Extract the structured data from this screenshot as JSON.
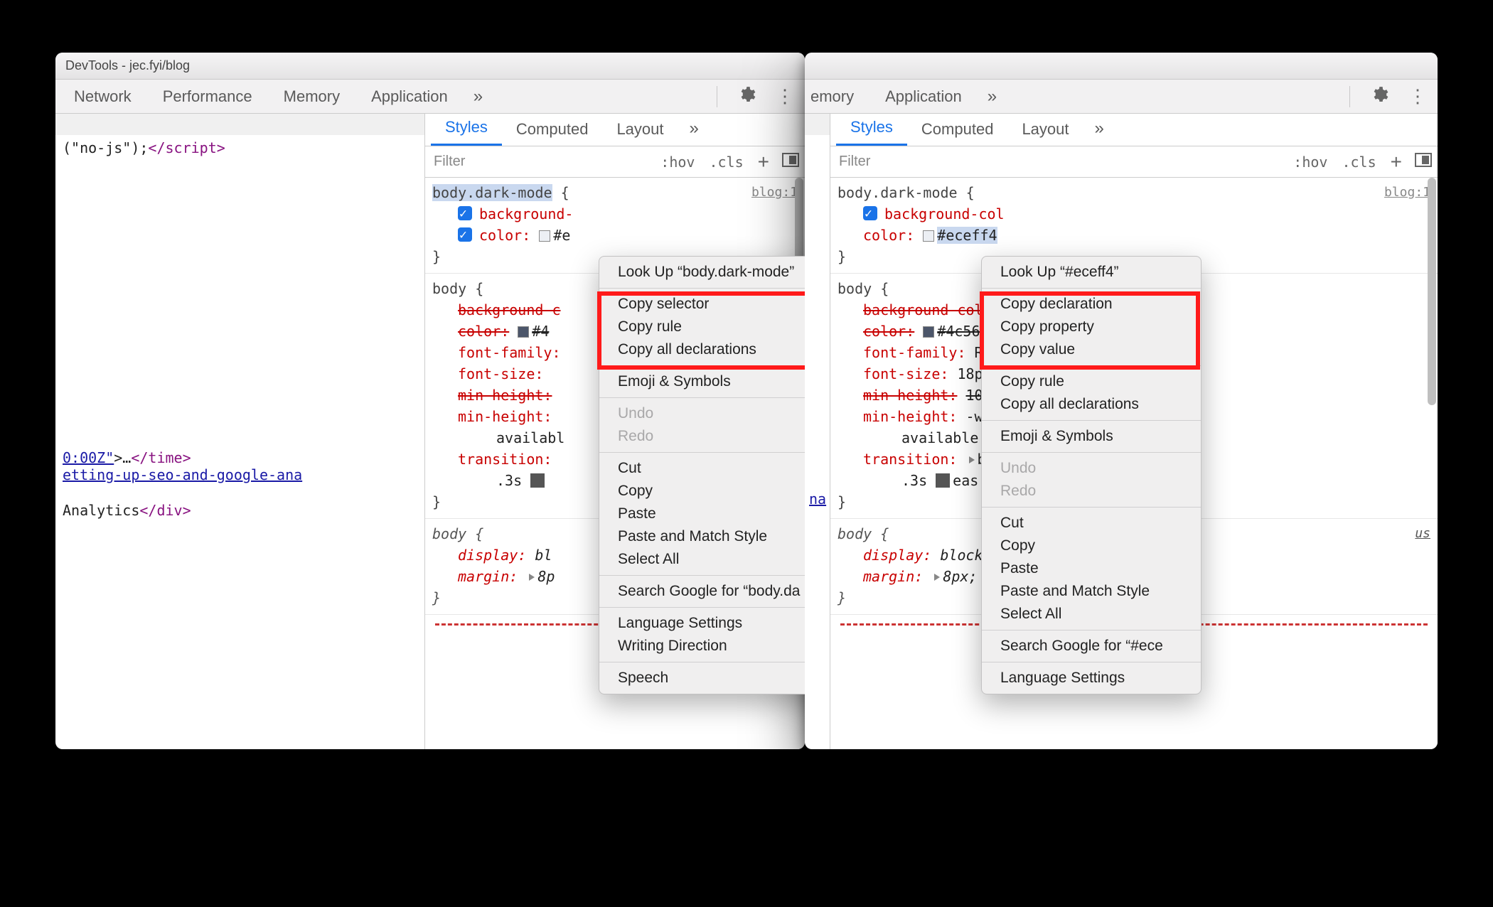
{
  "window": {
    "title": "DevTools - jec.fyi/blog"
  },
  "mainTabs": {
    "network": "Network",
    "performance": "Performance",
    "memory": "Memory",
    "application": "Application",
    "more": "»"
  },
  "subTabs": {
    "styles": "Styles",
    "computed": "Computed",
    "layout": "Layout",
    "more": "»"
  },
  "filterBar": {
    "placeholder": "Filter",
    "hov": ":hov",
    "cls": ".cls",
    "plus": "+"
  },
  "elements": {
    "snippet1": {
      "noJs": "(\"no-js\");",
      "closeScript": "</script>"
    },
    "snippet2": {
      "timeAttr": "0:00Z\"",
      "ellipsis": "…",
      "closeTime": "</time>",
      "link": "etting-up-seo-and-google-ana",
      "analytics": "Analytics",
      "closeDiv": "</div>"
    }
  },
  "rules": {
    "r1": {
      "selector": "body.dark-mode",
      "location": "blog:1",
      "p_bg": "background-",
      "p_color": "color:",
      "swatch": "#eceff4",
      "valhex": "#e",
      "valhex2": "#eceff4"
    },
    "r2": {
      "selector": "body",
      "p_bgc": "background-c",
      "p_bgcol": "background-col",
      "p_color": "color:",
      "swatch": "#4c566a",
      "v_color": "#4",
      "v_color2": "#4c56",
      "p_ff": "font-family:",
      "v_ff": "R",
      "p_fs": "font-size:",
      "v_fs": "18p",
      "p_mh": "min-height:",
      "v_mh": "10",
      "p_mh2": "min-height:",
      "v_mh2": "-w",
      "avail": "availabl",
      "avail2": "available",
      "p_tr": "transition:",
      "v_tr": "b",
      "v_dur": ".3s",
      "v_ease": "eas",
      "v_ease2": "eas"
    },
    "r3": {
      "selector": "body",
      "loc": "us",
      "p_disp": "display:",
      "v_disp": "bl",
      "v_disp2": "block;",
      "p_marg": "margin:",
      "v_marg": "8p",
      "v_marg2": "8px;"
    }
  },
  "ctx_common": {
    "emoji": "Emoji & Symbols",
    "undo": "Undo",
    "redo": "Redo",
    "cut": "Cut",
    "copy": "Copy",
    "paste": "Paste",
    "pasteMatch": "Paste and Match Style",
    "selAll": "Select All",
    "lang": "Language Settings",
    "writedir": "Writing Direction",
    "speech": "Speech"
  },
  "ctx1": {
    "lookup": "Look Up “body.dark-mode”",
    "copySel": "Copy selector",
    "copyRule": "Copy rule",
    "copyAll": "Copy all declarations",
    "search": "Search Google for “body.da"
  },
  "ctx2": {
    "lookup": "Look Up “#eceff4”",
    "copyDecl": "Copy declaration",
    "copyProp": "Copy property",
    "copyVal": "Copy value",
    "copyRule": "Copy rule",
    "copyAll": "Copy all declarations",
    "search": "Search Google for “#ece",
    "langShort": "Language Settings"
  }
}
